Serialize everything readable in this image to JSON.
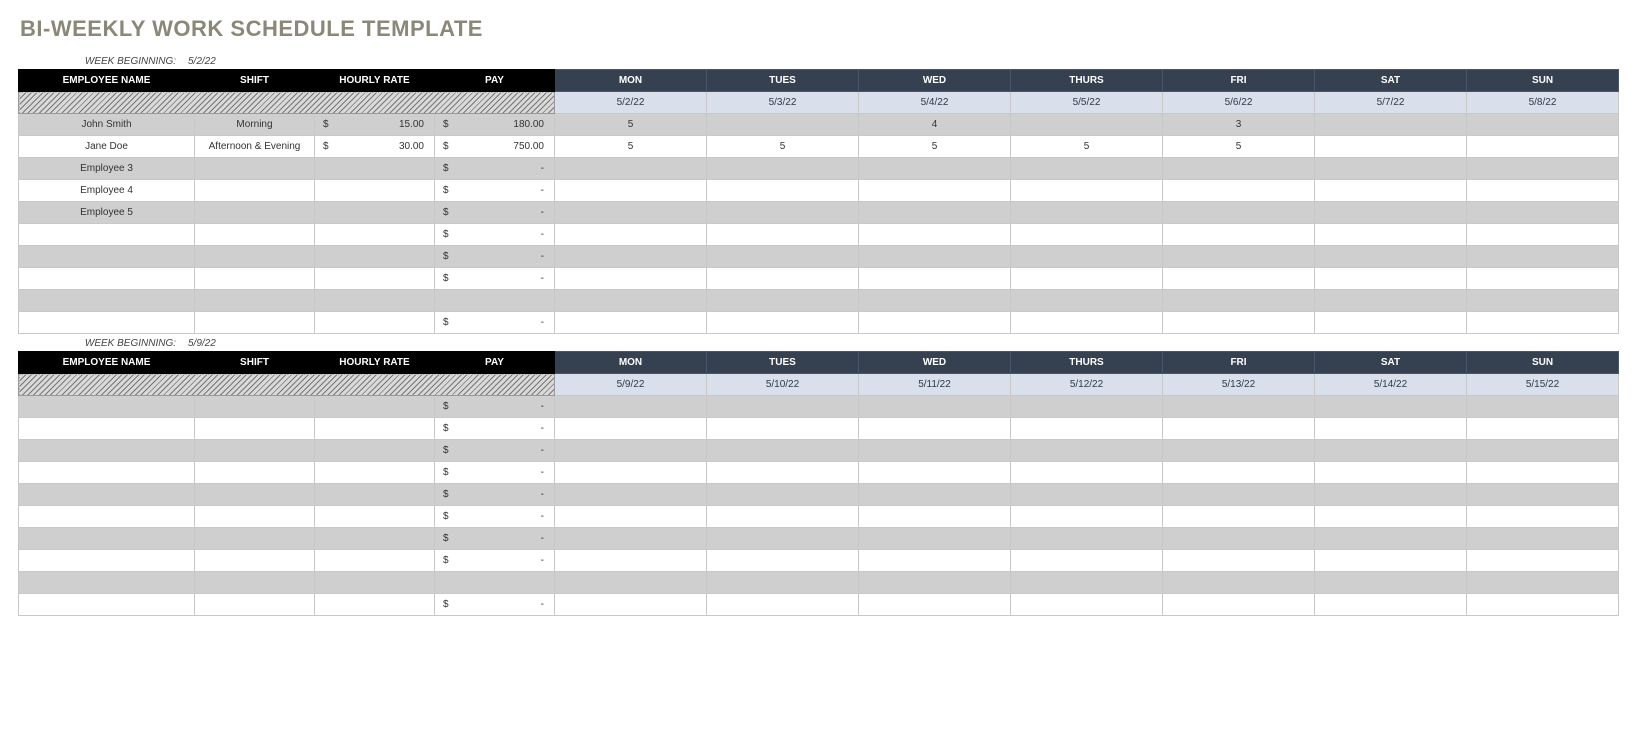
{
  "title": "BI-WEEKLY WORK SCHEDULE TEMPLATE",
  "week_beginning_label": "WEEK BEGINNING:",
  "currency_symbol": "$",
  "dash": "-",
  "headers": {
    "employee_name": "EMPLOYEE NAME",
    "shift": "SHIFT",
    "hourly_rate": "HOURLY RATE",
    "pay": "PAY",
    "days": [
      "MON",
      "TUES",
      "WED",
      "THURS",
      "FRI",
      "SAT",
      "SUN"
    ]
  },
  "weeks": [
    {
      "beginning": "5/2/22",
      "dates": [
        "5/2/22",
        "5/3/22",
        "5/4/22",
        "5/5/22",
        "5/6/22",
        "5/7/22",
        "5/8/22"
      ],
      "rows": [
        {
          "name": "John Smith",
          "shift": "Morning",
          "rate": "15.00",
          "pay": "180.00",
          "days": [
            "5",
            "",
            "4",
            "",
            "3",
            "",
            ""
          ]
        },
        {
          "name": "Jane Doe",
          "shift": "Afternoon & Evening",
          "rate": "30.00",
          "pay": "750.00",
          "days": [
            "5",
            "5",
            "5",
            "5",
            "5",
            "",
            ""
          ]
        },
        {
          "name": "Employee 3",
          "shift": "",
          "rate": "",
          "pay": "-",
          "days": [
            "",
            "",
            "",
            "",
            "",
            "",
            ""
          ]
        },
        {
          "name": "Employee 4",
          "shift": "",
          "rate": "",
          "pay": "-",
          "days": [
            "",
            "",
            "",
            "",
            "",
            "",
            ""
          ]
        },
        {
          "name": "Employee 5",
          "shift": "",
          "rate": "",
          "pay": "-",
          "days": [
            "",
            "",
            "",
            "",
            "",
            "",
            ""
          ]
        },
        {
          "name": "",
          "shift": "",
          "rate": "",
          "pay": "-",
          "days": [
            "",
            "",
            "",
            "",
            "",
            "",
            ""
          ]
        },
        {
          "name": "",
          "shift": "",
          "rate": "",
          "pay": "-",
          "days": [
            "",
            "",
            "",
            "",
            "",
            "",
            ""
          ]
        },
        {
          "name": "",
          "shift": "",
          "rate": "",
          "pay": "-",
          "days": [
            "",
            "",
            "",
            "",
            "",
            "",
            ""
          ]
        },
        {
          "name": "",
          "shift": "",
          "rate": "",
          "pay": "",
          "days": [
            "",
            "",
            "",
            "",
            "",
            "",
            ""
          ]
        },
        {
          "name": "",
          "shift": "",
          "rate": "",
          "pay": "-",
          "days": [
            "",
            "",
            "",
            "",
            "",
            "",
            ""
          ]
        }
      ]
    },
    {
      "beginning": "5/9/22",
      "dates": [
        "5/9/22",
        "5/10/22",
        "5/11/22",
        "5/12/22",
        "5/13/22",
        "5/14/22",
        "5/15/22"
      ],
      "rows": [
        {
          "name": "",
          "shift": "",
          "rate": "",
          "pay": "-",
          "days": [
            "",
            "",
            "",
            "",
            "",
            "",
            ""
          ]
        },
        {
          "name": "",
          "shift": "",
          "rate": "",
          "pay": "-",
          "days": [
            "",
            "",
            "",
            "",
            "",
            "",
            ""
          ]
        },
        {
          "name": "",
          "shift": "",
          "rate": "",
          "pay": "-",
          "days": [
            "",
            "",
            "",
            "",
            "",
            "",
            ""
          ]
        },
        {
          "name": "",
          "shift": "",
          "rate": "",
          "pay": "-",
          "days": [
            "",
            "",
            "",
            "",
            "",
            "",
            ""
          ]
        },
        {
          "name": "",
          "shift": "",
          "rate": "",
          "pay": "-",
          "days": [
            "",
            "",
            "",
            "",
            "",
            "",
            ""
          ]
        },
        {
          "name": "",
          "shift": "",
          "rate": "",
          "pay": "-",
          "days": [
            "",
            "",
            "",
            "",
            "",
            "",
            ""
          ]
        },
        {
          "name": "",
          "shift": "",
          "rate": "",
          "pay": "-",
          "days": [
            "",
            "",
            "",
            "",
            "",
            "",
            ""
          ]
        },
        {
          "name": "",
          "shift": "",
          "rate": "",
          "pay": "-",
          "days": [
            "",
            "",
            "",
            "",
            "",
            "",
            ""
          ]
        },
        {
          "name": "",
          "shift": "",
          "rate": "",
          "pay": "",
          "days": [
            "",
            "",
            "",
            "",
            "",
            "",
            ""
          ]
        },
        {
          "name": "",
          "shift": "",
          "rate": "",
          "pay": "-",
          "days": [
            "",
            "",
            "",
            "",
            "",
            "",
            ""
          ]
        }
      ]
    }
  ]
}
